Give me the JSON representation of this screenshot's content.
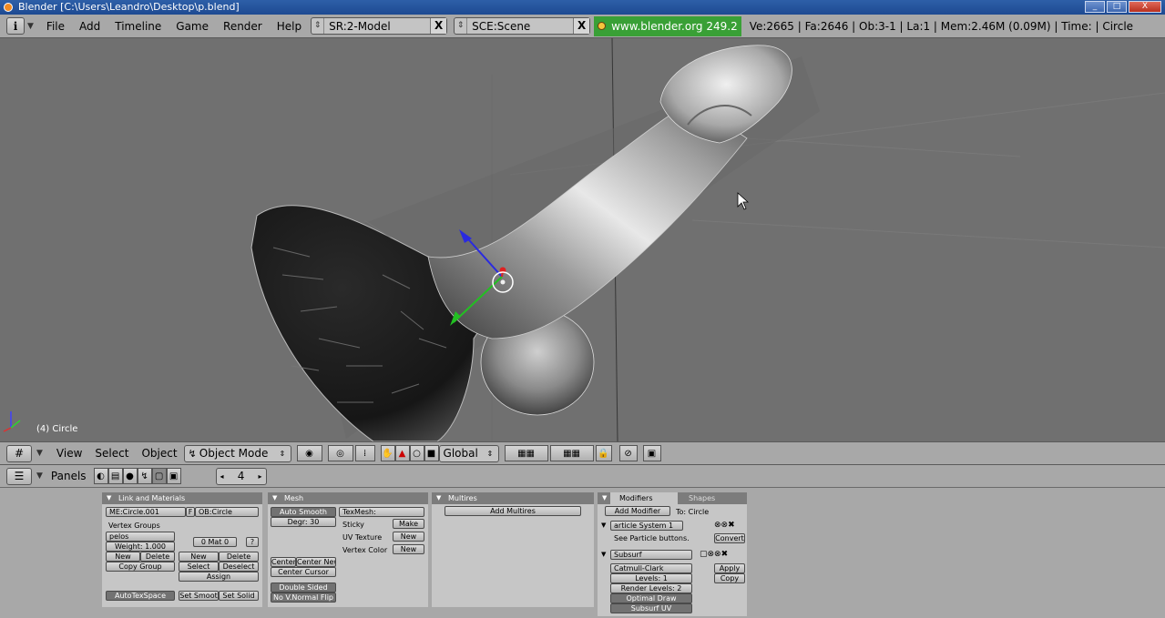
{
  "window": {
    "title": "Blender [C:\\Users\\Leandro\\Desktop\\p.blend]",
    "buttons": [
      "_",
      "□",
      "X"
    ]
  },
  "info_header": {
    "menus": [
      "File",
      "Add",
      "Timeline",
      "Game",
      "Render",
      "Help"
    ],
    "screen": "SR:2-Model",
    "scene": "SCE:Scene",
    "version": "www.blender.org 249.2",
    "stats": "Ve:2665 | Fa:2646 | Ob:3-1 | La:1  | Mem:2.46M (0.09M)  | Time: | Circle"
  },
  "viewport": {
    "object_label": "(4) Circle"
  },
  "view3d_header": {
    "menus": [
      "View",
      "Select",
      "Object"
    ],
    "mode": "Object Mode",
    "orientation": "Global"
  },
  "buttons_header": {
    "panels_label": "Panels",
    "frame": "4"
  },
  "link_materials": {
    "title": "Link and Materials",
    "mesh_name": "ME:Circle.001",
    "f_label": "F",
    "ob_name": "OB:Circle",
    "vertex_groups_label": "Vertex Groups",
    "group_name": "pelos",
    "weight": "Weight: 1.000",
    "mat": "0 Mat 0",
    "question": "?",
    "new": "New",
    "delete": "Delete",
    "copy_group": "Copy Group",
    "new2": "New",
    "delete2": "Delete",
    "select": "Select",
    "deselect": "Deselect",
    "assign": "Assign",
    "autotexspace": "AutoTexSpace",
    "set_smooth": "Set Smoot",
    "set_solid": "Set Solid"
  },
  "mesh": {
    "title": "Mesh",
    "auto_smooth": "Auto Smooth",
    "degr": "Degr: 30",
    "texmesh": "TexMesh:",
    "sticky": "Sticky",
    "make": "Make",
    "uv_texture": "UV Texture",
    "new1": "New",
    "vertex_color": "Vertex Color",
    "new2": "New",
    "center": "Center",
    "center_new": "Center New",
    "center_cursor": "Center Cursor",
    "double_sided": "Double Sided",
    "no_vnormal_flip": "No V.Normal Flip"
  },
  "multires": {
    "title": "Multires",
    "add_multires": "Add Multires"
  },
  "modifiers": {
    "tab_modifiers": "Modifiers",
    "tab_shapes": "Shapes",
    "add_modifier": "Add Modifier",
    "to": "To: Circle",
    "particle_system": "article System 1",
    "see_particle": "See Particle buttons.",
    "convert": "Convert",
    "subsurf": "Subsurf",
    "catmull": "Catmull-Clark",
    "levels": "Levels: 1",
    "render_levels": "Render Levels: 2",
    "optimal_draw": "Optimal Draw",
    "subsurf_uv": "Subsurf UV",
    "apply": "Apply",
    "copy": "Copy"
  }
}
